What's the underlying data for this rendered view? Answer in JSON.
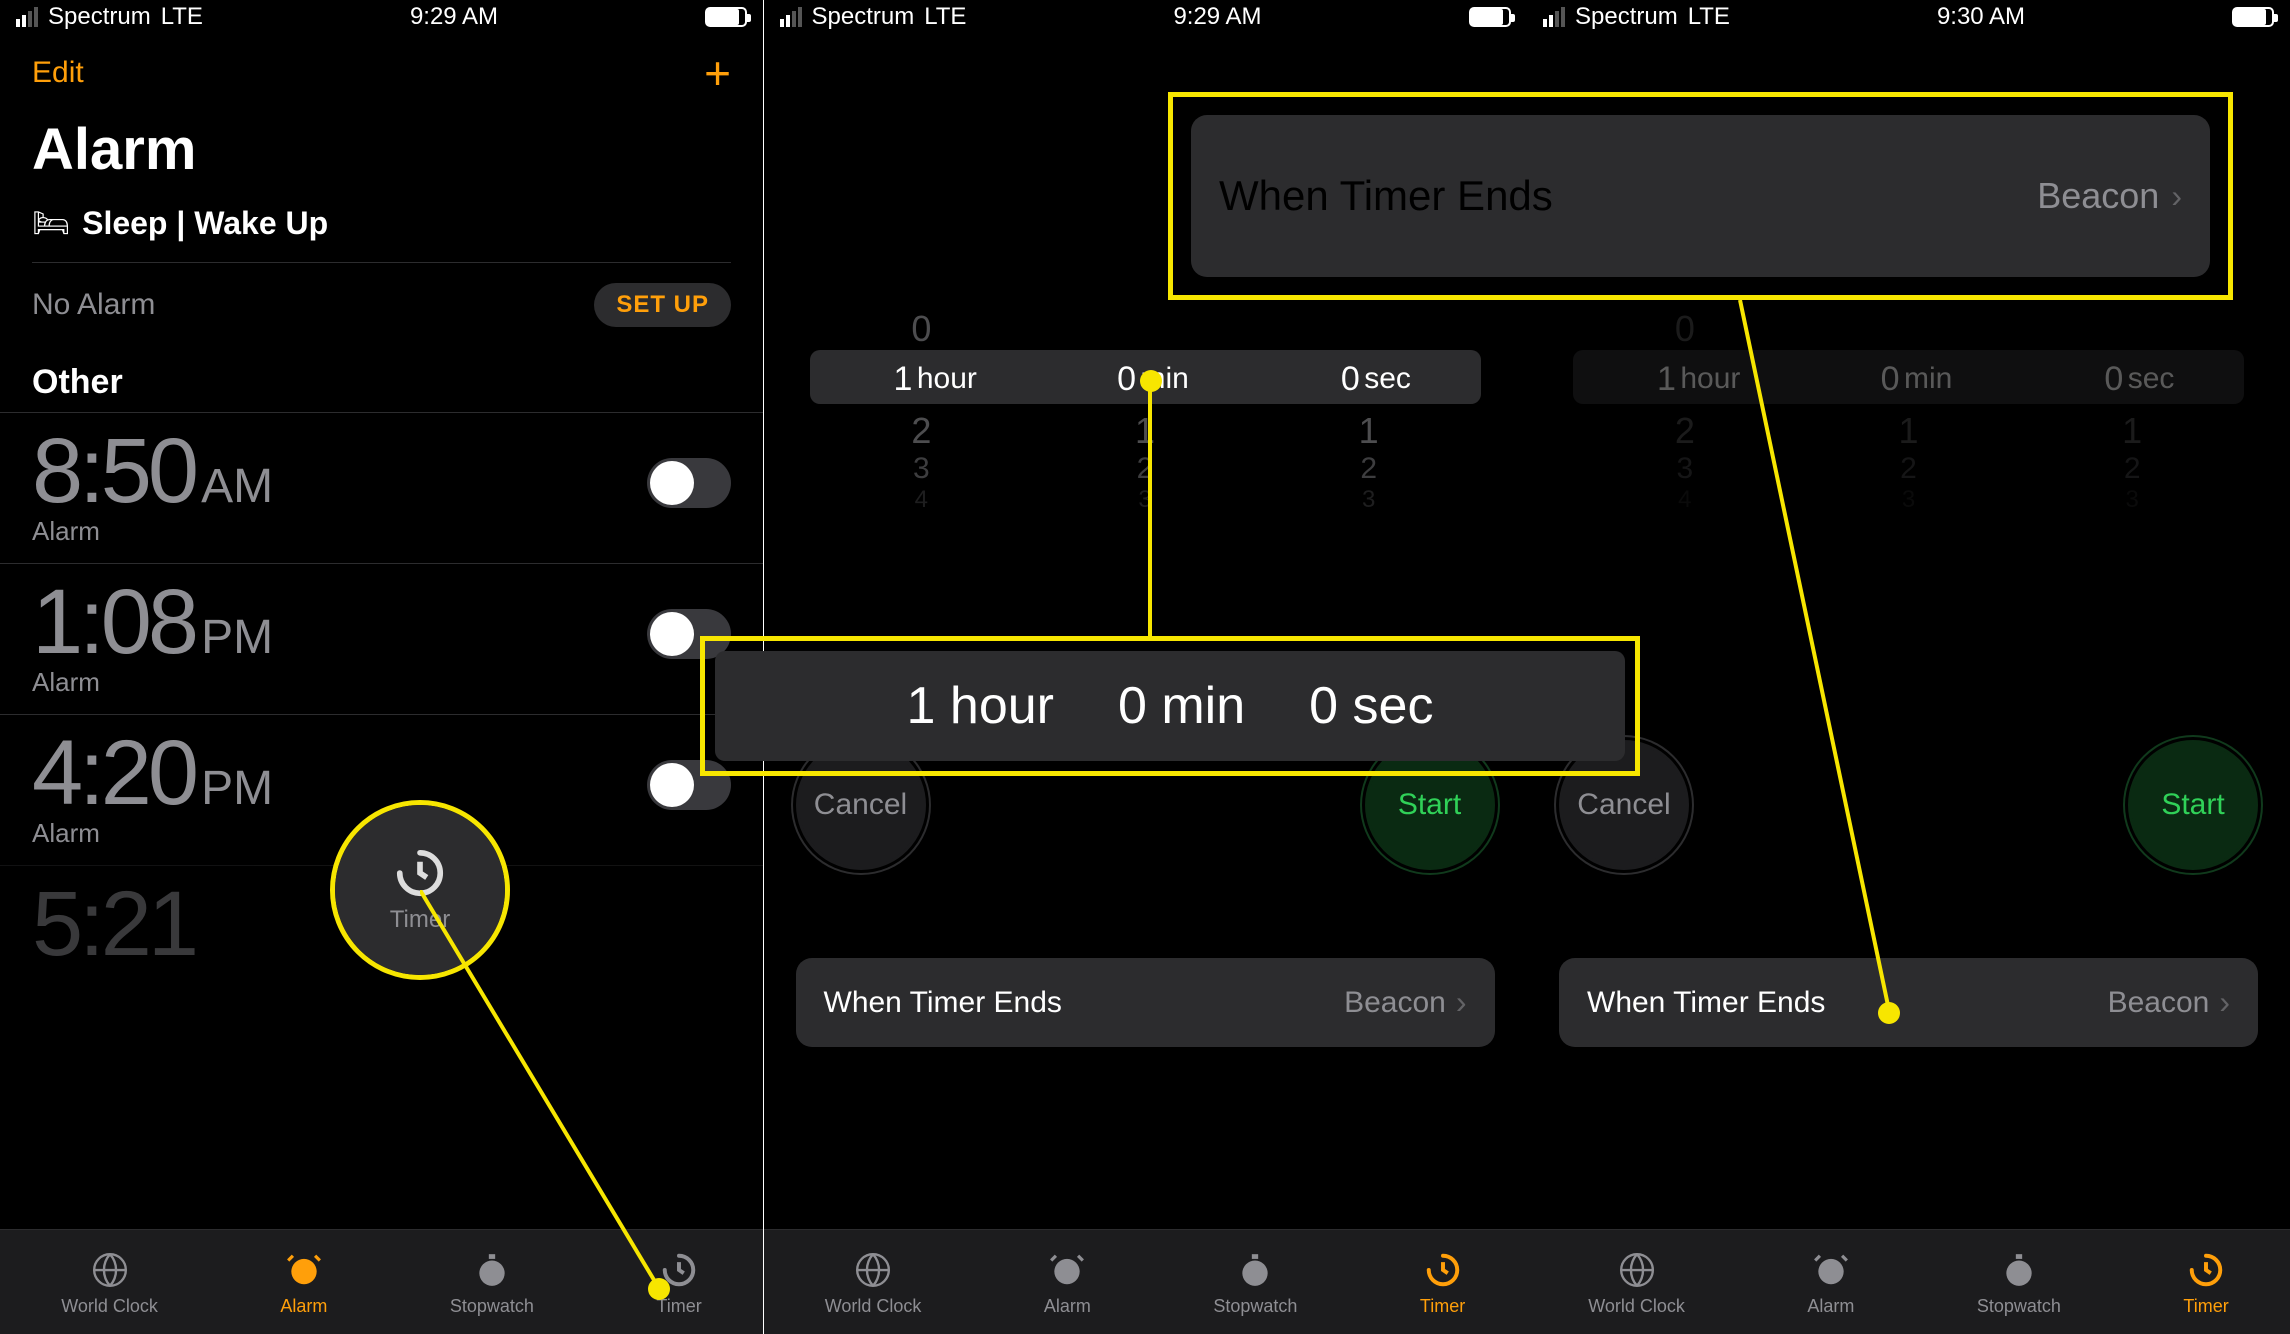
{
  "screens": [
    {
      "statusbar": {
        "carrier": "Spectrum",
        "network": "LTE",
        "time": "9:29 AM"
      },
      "nav": {
        "edit": "Edit"
      },
      "title": "Alarm",
      "sleep_label": "Sleep | Wake Up",
      "no_alarm_text": "No Alarm",
      "setup_label": "SET UP",
      "other_header": "Other",
      "alarms": [
        {
          "time": "8:50",
          "ampm": "AM",
          "label": "Alarm",
          "enabled": false
        },
        {
          "time": "1:08",
          "ampm": "PM",
          "label": "Alarm",
          "enabled": false
        },
        {
          "time": "4:20",
          "ampm": "PM",
          "label": "Alarm",
          "enabled": false
        },
        {
          "time": "5:21",
          "ampm": "",
          "label": "",
          "enabled": false
        }
      ],
      "tabs": [
        {
          "label": "World Clock"
        },
        {
          "label": "Alarm"
        },
        {
          "label": "Stopwatch"
        },
        {
          "label": "Timer"
        }
      ],
      "active_tab": "Alarm"
    },
    {
      "statusbar": {
        "carrier": "Spectrum",
        "network": "LTE",
        "time": "9:29 AM"
      },
      "picker": {
        "hour_val": "1",
        "hour_unit": "hour",
        "min_val": "0",
        "min_unit": "min",
        "sec_val": "0",
        "sec_unit": "sec",
        "above": "0",
        "below": [
          "2",
          "3",
          "4"
        ]
      },
      "cancel_label": "Cancel",
      "start_label": "Start",
      "when_ends": {
        "label": "When Timer Ends",
        "value": "Beacon"
      },
      "tabs": [
        {
          "label": "World Clock"
        },
        {
          "label": "Alarm"
        },
        {
          "label": "Stopwatch"
        },
        {
          "label": "Timer"
        }
      ],
      "active_tab": "Timer"
    },
    {
      "statusbar": {
        "carrier": "Spectrum",
        "network": "LTE",
        "time": "9:30 AM"
      },
      "picker": {
        "hour_val": "1",
        "hour_unit": "hour",
        "min_val": "0",
        "min_unit": "min",
        "sec_val": "0",
        "sec_unit": "sec",
        "above": "0",
        "below": [
          "2",
          "3",
          "4"
        ]
      },
      "cancel_label": "Cancel",
      "start_label": "Start",
      "when_ends_top": {
        "label": "When Timer Ends",
        "value": "Beacon"
      },
      "when_ends": {
        "label": "When Timer Ends",
        "value": "Beacon"
      },
      "tabs": [
        {
          "label": "World Clock"
        },
        {
          "label": "Alarm"
        },
        {
          "label": "Stopwatch"
        },
        {
          "label": "Timer"
        }
      ],
      "active_tab": "Timer"
    }
  ],
  "callouts": {
    "timer_tab_label": "Timer",
    "picker_zoom": {
      "h": "1",
      "h_unit": "hour",
      "m": "0",
      "m_unit": "min",
      "s": "0",
      "s_unit": "sec"
    }
  },
  "colors": {
    "accent": "#ff9f0a",
    "highlight": "#f7e600",
    "start_green": "#30d158"
  }
}
